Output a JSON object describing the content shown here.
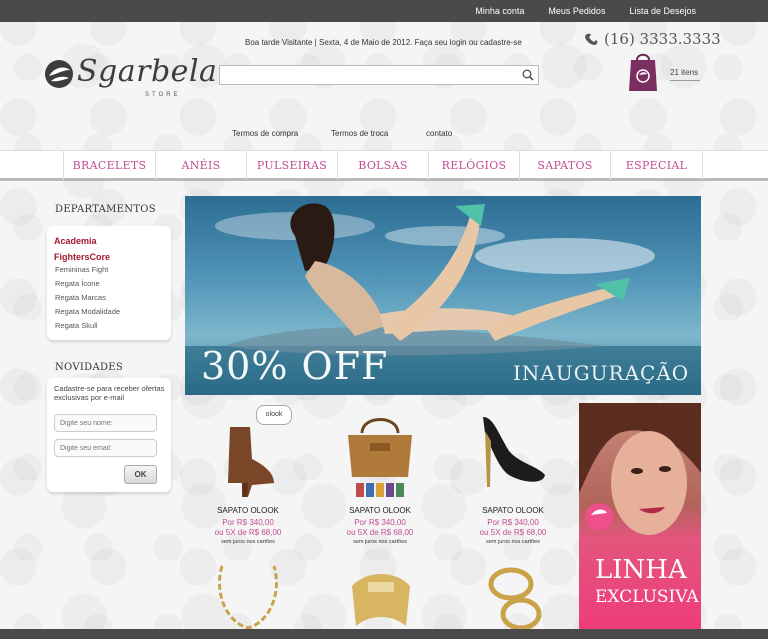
{
  "topbar": {
    "links": [
      "Minha conta",
      "Meus Pedidos",
      "Lista de Desejos"
    ]
  },
  "header": {
    "logo_text": "Sgarbela",
    "logo_sub": "STORE",
    "greeting": "Boa tarde Visitante | Sexta, 4 de Maio de 2012. Faça seu login ou cadastre-se",
    "search_placeholder": "",
    "phone": "(16) 3333.3333",
    "cart_items": "21 itens",
    "info_links": [
      "Termos de compra",
      "Termos de troca",
      "contato"
    ]
  },
  "nav": {
    "items": [
      "BRACELETS",
      "ANÉIS",
      "PULSEIRAS",
      "BOLSAS",
      "RELÓGIOS",
      "SAPATOS",
      "ESPECIAL"
    ]
  },
  "departments": {
    "title": "DEPARTAMENTOS",
    "main1": "Academia",
    "main2": "FightersCore",
    "subs": [
      "Femininas Fight",
      "Regata Ícone",
      "Regata Marcas",
      "Regata Modalidade",
      "Regata Skull"
    ]
  },
  "newsletter": {
    "title": "NOVIDADES",
    "text": "Cadastre-se para receber ofertas exclusivas por e-mail",
    "name_placeholder": "Digite seu nome:",
    "email_placeholder": "Digite seu email:",
    "ok_label": "OK"
  },
  "banner": {
    "headline": "30% OFF",
    "sub": "INAUGURAÇÃO"
  },
  "products": [
    {
      "name": "SAPATO OLOOK",
      "price": "Por R$ 340,00",
      "installments": "ou 5X de R$ 68,00",
      "note": "sem juros nos cartões",
      "badge": "olook"
    },
    {
      "name": "SAPATO OLOOK",
      "price": "Por R$ 340,00",
      "installments": "ou 5X de R$ 68,00",
      "note": "sem juros nos cartões"
    },
    {
      "name": "SAPATO OLOOK",
      "price": "Por R$ 340,00",
      "installments": "ou 5X de R$ 68,00",
      "note": "sem juros nos cartões"
    }
  ],
  "promo": {
    "line1": "LINHA",
    "line2": "EXCLUSIVA"
  },
  "colors": {
    "accent": "#c24d92",
    "dept": "#a3182f",
    "topbar": "#4a4a4a"
  }
}
